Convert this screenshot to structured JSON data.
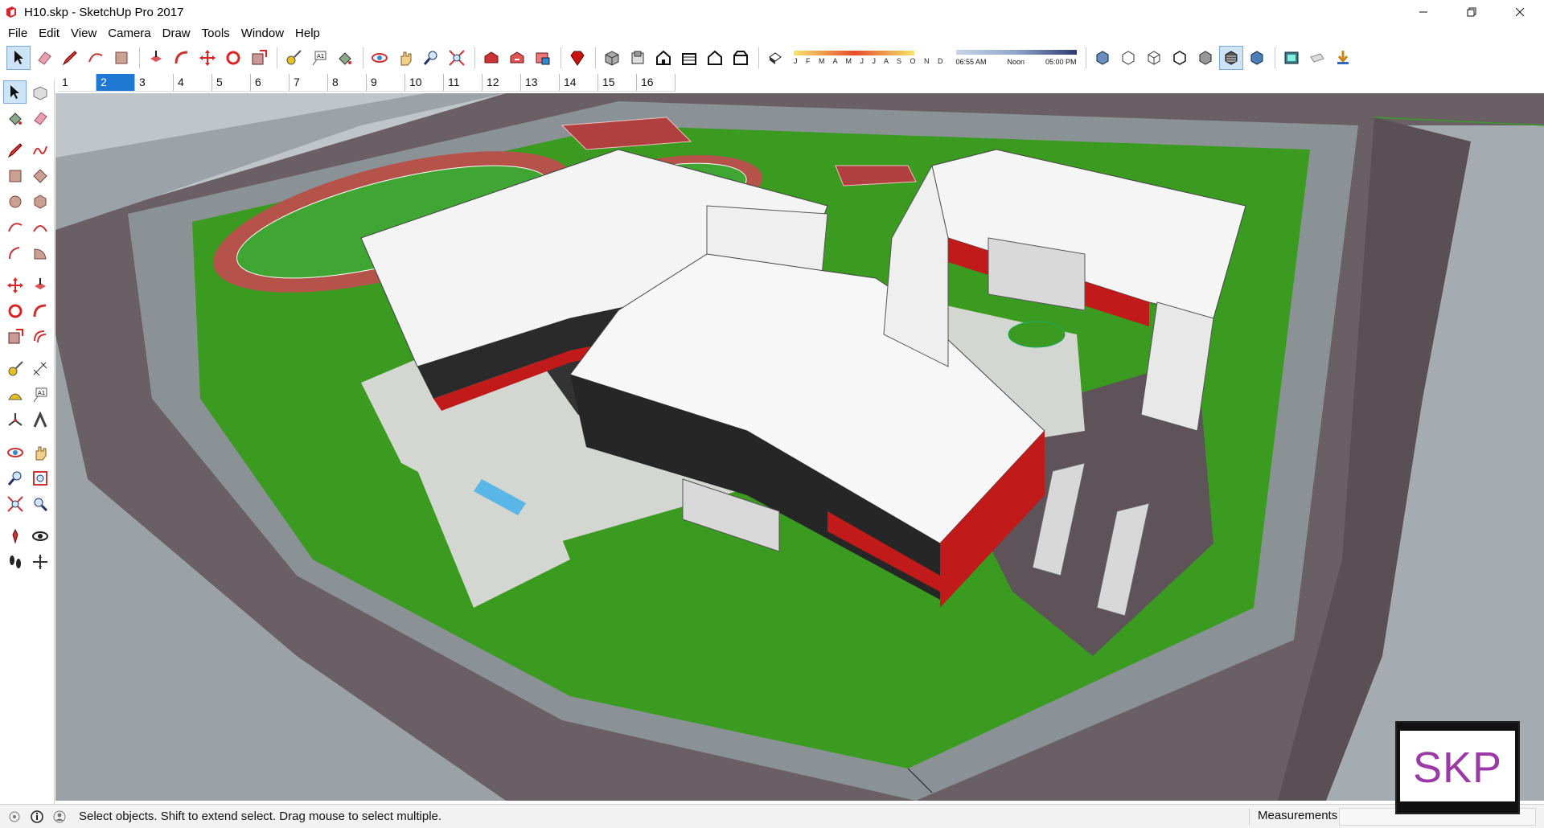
{
  "window": {
    "title": "H10.skp - SketchUp Pro 2017",
    "controls": [
      "minimize",
      "restore",
      "close"
    ]
  },
  "menu": {
    "items": [
      "File",
      "Edit",
      "View",
      "Camera",
      "Draw",
      "Tools",
      "Window",
      "Help"
    ]
  },
  "toolbar": {
    "groups": [
      [
        "select-icon",
        "eraser-icon",
        "pencil-icon",
        "arc-icon",
        "paint-icon"
      ],
      [
        "push-pull-icon",
        "follow-me-icon",
        "move-icon",
        "rotate-icon",
        "scale-icon"
      ],
      [
        "tape-measure-icon",
        "text-icon",
        "paint-bucket-icon"
      ],
      [
        "orbit-icon",
        "pan-icon",
        "zoom-icon",
        "zoom-extents-icon"
      ],
      [
        "warehouse-icon",
        "share-model-icon",
        "extension-icon"
      ],
      [
        "ruby-icon"
      ],
      [
        "iso-view-icon",
        "top-view-icon",
        "front-view-icon",
        "right-view-icon",
        "back-view-icon",
        "left-view-icon"
      ],
      [
        "shadow-toggle-icon"
      ]
    ],
    "shadow_months": "J F M A M J J A S O N D",
    "shadow_time_start": "06:55 AM",
    "shadow_time_mid": "Noon",
    "shadow_time_end": "05:00 PM",
    "style_group": [
      "xray-icon",
      "back-edges-icon",
      "wireframe-icon",
      "hidden-line-icon",
      "shaded-icon",
      "shaded-textures-icon",
      "monochrome-icon"
    ],
    "extra_group": [
      "layers-icon",
      "section-icon",
      "import-icon"
    ]
  },
  "scenes": {
    "tabs": [
      "1",
      "2",
      "3",
      "4",
      "5",
      "6",
      "7",
      "8",
      "9",
      "10",
      "11",
      "12",
      "13",
      "14",
      "15",
      "16"
    ],
    "active_index": 1
  },
  "left_tools": [
    [
      "select-tool-icon",
      "component-tool-icon"
    ],
    [
      "paint-bucket-tool-icon",
      "eraser-tool-icon"
    ],
    [
      "line-tool-icon",
      "freehand-tool-icon"
    ],
    [
      "rectangle-tool-icon",
      "rotated-rectangle-tool-icon"
    ],
    [
      "circle-tool-icon",
      "polygon-tool-icon"
    ],
    [
      "arc-tool-icon",
      "two-point-arc-tool-icon"
    ],
    [
      "three-point-arc-tool-icon",
      "pie-tool-icon"
    ],
    [
      "move-tool-icon",
      "push-pull-tool-icon"
    ],
    [
      "rotate-tool-icon",
      "follow-me-tool-icon"
    ],
    [
      "scale-tool-icon",
      "offset-tool-icon"
    ],
    [
      "tape-measure-tool-icon",
      "dimension-tool-icon"
    ],
    [
      "protractor-tool-icon",
      "text-tool-icon"
    ],
    [
      "axes-tool-icon",
      "3d-text-tool-icon"
    ],
    [
      "orbit-tool-icon",
      "pan-tool-icon"
    ],
    [
      "zoom-tool-icon",
      "zoom-window-tool-icon"
    ],
    [
      "zoom-extents-tool-icon",
      "previous-view-tool-icon"
    ],
    [
      "position-camera-tool-icon",
      "look-around-tool-icon"
    ],
    [
      "walk-tool-icon",
      "section-plane-tool-icon"
    ]
  ],
  "status": {
    "message": "Select objects. Shift to extend select. Drag mouse to select multiple.",
    "measurements_label": "Measurements",
    "measurements_value": ""
  },
  "watermark": {
    "text": "SKP"
  },
  "colors": {
    "accent": "#1f78d1",
    "ground_grey": "#8a9296",
    "road": "#5a4f55",
    "lawn": "#3b9b21",
    "building_white": "#f4f4f4",
    "facade_red": "#c01a1a",
    "track_red": "#b5524a",
    "watermark_purple": "#9b3aa6"
  }
}
